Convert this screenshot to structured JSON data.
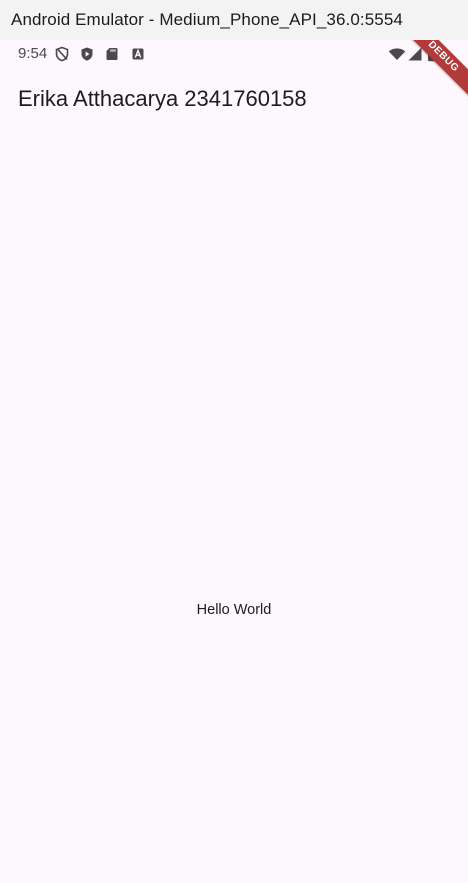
{
  "window": {
    "title": "Android Emulator - Medium_Phone_API_36.0:5554"
  },
  "status_bar": {
    "time": "9:54",
    "left_icons": [
      "shield-outline-icon",
      "play-protect-icon",
      "sd-card-icon",
      "font-a-icon"
    ],
    "right_icons": [
      "wifi-icon",
      "cellular-signal-icon",
      "battery-icon"
    ]
  },
  "app": {
    "appbar_title": "Erika Atthacarya 2341760158",
    "body_text": "Hello World",
    "debug_banner": "DEBUG"
  },
  "colors": {
    "background": "#fdf7fe",
    "titlebar": "#f3f3f3",
    "debug_ribbon": "#b23a3a",
    "text": "#1d1b20"
  }
}
